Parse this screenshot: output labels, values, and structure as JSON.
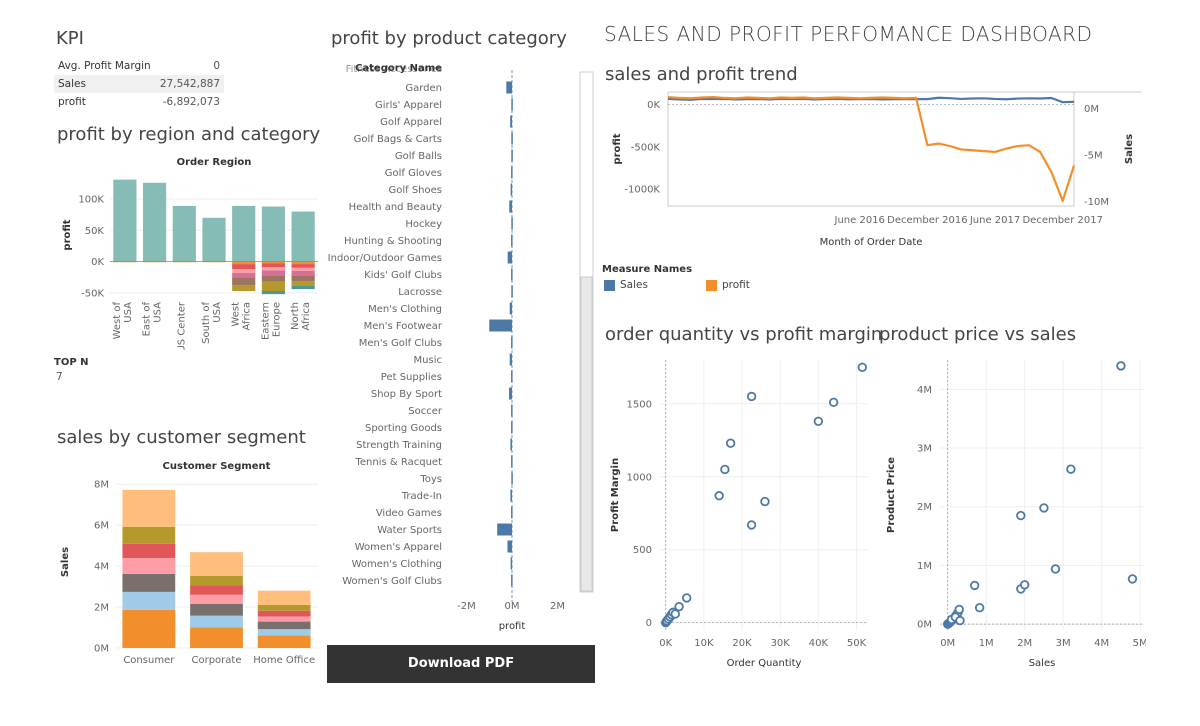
{
  "dashboard_title": "SALES AND PROFIT PERFOMANCE DASHBOARD",
  "kpi": {
    "title": "KPI",
    "rows": [
      {
        "label": "Avg. Profit Margin",
        "value": "0"
      },
      {
        "label": "Sales",
        "value": "27,542,887"
      },
      {
        "label": "profit",
        "value": "-6,892,073"
      }
    ]
  },
  "top_n": {
    "label": "TOP N",
    "value": "7"
  },
  "download_button": "Download PDF",
  "colors": {
    "blue": "#4e79a7",
    "orange": "#f28e2b",
    "teal": "#86bcb6"
  },
  "chart_data": [
    {
      "id": "region",
      "type": "bar",
      "title": "profit by region and category",
      "header": "Order Region",
      "ylabel": "profit",
      "ylim": [
        -55000,
        140000
      ],
      "yticks": [
        100000,
        50000,
        0,
        -50000
      ],
      "ytick_labels": [
        "100K",
        "50K",
        "0K",
        "-50K"
      ],
      "categories": [
        "West of USA",
        "East of USA",
        "US Center",
        "South of USA",
        "West Africa",
        "Eastern Europe",
        "North Africa"
      ],
      "category_labels": [
        [
          "West of",
          "USA"
        ],
        [
          "East of",
          "USA"
        ],
        [
          "US Center"
        ],
        [
          "South of",
          "USA"
        ],
        [
          "West",
          "Africa"
        ],
        [
          "Eastern",
          "Europe"
        ],
        [
          "North",
          "Africa"
        ]
      ],
      "positive": [
        131000,
        126000,
        89000,
        70000,
        89000,
        88000,
        80000
      ],
      "negative_segments": [
        [
          -1000
        ],
        [
          -1000
        ],
        [
          -1000
        ],
        [
          -1000
        ],
        [
          -4000,
          -8000,
          -6000,
          -7000,
          -13000,
          -9000
        ],
        [
          -3000,
          -6000,
          -5000,
          -8000,
          -10000,
          -15000,
          -5000
        ],
        [
          -4000,
          -6000,
          -5000,
          -7000,
          -9000,
          -8000,
          -5000
        ]
      ],
      "segment_colors": [
        "#f28e2b",
        "#e15759",
        "#ff9da7",
        "#d37295",
        "#9c755f",
        "#b6992d",
        "#499894",
        "#79706e"
      ]
    },
    {
      "id": "segment",
      "type": "bar",
      "title": "sales by customer segment",
      "header": "Customer Segment",
      "ylabel": "Sales",
      "ylim": [
        0,
        8400000
      ],
      "yticks": [
        0,
        2000000,
        4000000,
        6000000,
        8000000
      ],
      "ytick_labels": [
        "0M",
        "2M",
        "4M",
        "6M",
        "8M"
      ],
      "categories": [
        "Consumer",
        "Corporate",
        "Home Office"
      ],
      "stack_colors": [
        "#f28e2b",
        "#a0cbe8",
        "#79706e",
        "#ff9da7",
        "#e15759",
        "#b6992d",
        "#ffbe7d"
      ],
      "stacks": [
        [
          1860000,
          880000,
          880000,
          770000,
          700000,
          830000,
          1800000
        ],
        [
          1000000,
          580000,
          580000,
          440000,
          450000,
          480000,
          1150000
        ],
        [
          620000,
          300000,
          370000,
          250000,
          280000,
          280000,
          700000
        ]
      ]
    },
    {
      "id": "category",
      "type": "bar",
      "orientation": "horizontal",
      "title": "profit by product category",
      "ylabel": "Category Name",
      "xlabel": "profit",
      "xlim": [
        -2900000,
        2900000
      ],
      "xticks": [
        -2000000,
        0,
        2000000
      ],
      "xtick_labels": [
        "-2M",
        "0M",
        "2M"
      ],
      "top_partial_label": "Fitness Accessories",
      "categories": [
        "Garden",
        "Girls' Apparel",
        "Golf Apparel",
        "Golf Bags & Carts",
        "Golf Balls",
        "Golf Gloves",
        "Golf Shoes",
        "Health and Beauty",
        "Hockey",
        "Hunting & Shooting",
        "Indoor/Outdoor Games",
        "Kids' Golf Clubs",
        "Lacrosse",
        "Men's Clothing",
        "Men's Footwear",
        "Men's Golf Clubs",
        "Music",
        "Pet Supplies",
        "Shop By Sport",
        "Soccer",
        "Sporting Goods",
        "Strength Training",
        "Tennis & Racquet",
        "Toys",
        "Trade-In",
        "Video Games",
        "Water Sports",
        "Women's Apparel",
        "Women's Clothing",
        "Women's Golf Clubs"
      ],
      "values": [
        -250000,
        -30000,
        -80000,
        -30000,
        -30000,
        -40000,
        -60000,
        -120000,
        -30000,
        -40000,
        -190000,
        -40000,
        -30000,
        -100000,
        -1000000,
        -40000,
        -100000,
        -40000,
        -130000,
        -40000,
        -40000,
        -70000,
        -40000,
        -30000,
        -70000,
        -40000,
        -650000,
        -200000,
        -60000,
        -40000
      ]
    },
    {
      "id": "trend",
      "type": "line",
      "title": "sales and profit trend",
      "xlabel": "Month of Order Date",
      "ylabel": "profit",
      "y2label": "Sales",
      "ylim": [
        -1200000,
        150000
      ],
      "yticks": [
        0,
        -500000,
        -1000000
      ],
      "ytick_labels": [
        "0K",
        "-500K",
        "-1000K"
      ],
      "y2lim": [
        -10500000,
        1800000
      ],
      "y2ticks": [
        0,
        -5000000,
        -10000000
      ],
      "y2tick_labels": [
        "0M",
        "-5M",
        "-10M"
      ],
      "x_start": "2015-01",
      "x_end": "2018-01",
      "xticks": [
        "2016-06",
        "2016-12",
        "2017-06",
        "2017-12"
      ],
      "xtick_labels": [
        "June 2016",
        "December 2016",
        "June 2017",
        "December 2017"
      ],
      "x": [
        "2015-01",
        "2015-02",
        "2015-03",
        "2015-04",
        "2015-05",
        "2015-06",
        "2015-07",
        "2015-08",
        "2015-09",
        "2015-10",
        "2015-11",
        "2015-12",
        "2016-01",
        "2016-02",
        "2016-03",
        "2016-04",
        "2016-05",
        "2016-06",
        "2016-07",
        "2016-08",
        "2016-09",
        "2016-10",
        "2016-11",
        "2016-12",
        "2017-01",
        "2017-02",
        "2017-03",
        "2017-04",
        "2017-05",
        "2017-06",
        "2017-07",
        "2017-08",
        "2017-09",
        "2017-10",
        "2017-11",
        "2017-12",
        "2018-01"
      ],
      "series": [
        {
          "name": "Sales",
          "axis": "y2",
          "color": "#4e79a7",
          "values": [
            1050000,
            1000000,
            960000,
            1060000,
            1040000,
            1050000,
            1000000,
            1030000,
            1040000,
            1000000,
            1050000,
            1040000,
            1060000,
            1000000,
            1040000,
            1050000,
            1010000,
            1030000,
            1040000,
            1000000,
            1030000,
            1030000,
            1030000,
            1030000,
            1180000,
            1130000,
            1050000,
            1100000,
            1120000,
            1050000,
            1020000,
            1090000,
            1120000,
            1100000,
            1150000,
            700000,
            740000
          ]
        },
        {
          "name": "profit",
          "axis": "y",
          "color": "#f28e2b",
          "values": [
            90000,
            80000,
            75000,
            85000,
            90000,
            80000,
            75000,
            85000,
            80000,
            75000,
            85000,
            80000,
            85000,
            75000,
            80000,
            85000,
            80000,
            75000,
            80000,
            85000,
            80000,
            75000,
            80000,
            -480000,
            -460000,
            -490000,
            -530000,
            -540000,
            -550000,
            -560000,
            -520000,
            -490000,
            -480000,
            -560000,
            -800000,
            -1140000,
            -720000
          ]
        }
      ],
      "legend": {
        "title": "Measure Names",
        "items": [
          "Sales",
          "profit"
        ]
      }
    },
    {
      "id": "qty_margin",
      "type": "scatter",
      "title": "order quantity vs profit margin",
      "xlabel": "Order Quantity",
      "ylabel": "Profit Margin",
      "xlim": [
        -1500,
        53000
      ],
      "ylim": [
        -50,
        1800
      ],
      "xticks": [
        0,
        10000,
        20000,
        30000,
        40000,
        50000
      ],
      "xtick_labels": [
        "0K",
        "10K",
        "20K",
        "30K",
        "40K",
        "50K"
      ],
      "yticks": [
        0,
        500,
        1000,
        1500
      ],
      "ytick_labels": [
        "0",
        "500",
        "1000",
        "1500"
      ],
      "points": [
        [
          0,
          0
        ],
        [
          200,
          8
        ],
        [
          400,
          15
        ],
        [
          600,
          20
        ],
        [
          800,
          28
        ],
        [
          1000,
          35
        ],
        [
          1200,
          42
        ],
        [
          1400,
          50
        ],
        [
          1600,
          58
        ],
        [
          1800,
          65
        ],
        [
          2000,
          72
        ],
        [
          300,
          12
        ],
        [
          700,
          25
        ],
        [
          1100,
          40
        ],
        [
          1500,
          55
        ],
        [
          1900,
          70
        ],
        [
          2500,
          60
        ],
        [
          3500,
          110
        ],
        [
          5500,
          170
        ],
        [
          14000,
          870
        ],
        [
          15500,
          1050
        ],
        [
          17000,
          1230
        ],
        [
          22500,
          1550
        ],
        [
          22500,
          670
        ],
        [
          26000,
          830
        ],
        [
          40000,
          1380
        ],
        [
          44000,
          1510
        ],
        [
          51500,
          1750
        ]
      ]
    },
    {
      "id": "price_sales",
      "type": "scatter",
      "title": "product price vs sales",
      "xlabel": "Sales",
      "ylabel": "Product Price",
      "xlim": [
        -200000,
        5100000
      ],
      "ylim": [
        -100000,
        4500000
      ],
      "xticks": [
        0,
        1000000,
        2000000,
        3000000,
        4000000,
        5000000
      ],
      "xtick_labels": [
        "0M",
        "1M",
        "2M",
        "3M",
        "4M",
        "5M"
      ],
      "yticks": [
        0,
        1000000,
        2000000,
        3000000,
        4000000
      ],
      "ytick_labels": [
        "0M",
        "1M",
        "2M",
        "3M",
        "4M"
      ],
      "points": [
        [
          0,
          0
        ],
        [
          30000,
          15000
        ],
        [
          60000,
          30000
        ],
        [
          90000,
          50000
        ],
        [
          120000,
          70000
        ],
        [
          150000,
          90000
        ],
        [
          180000,
          110000
        ],
        [
          210000,
          140000
        ],
        [
          240000,
          170000
        ],
        [
          270000,
          200000
        ],
        [
          300000,
          250000
        ],
        [
          100000,
          80000
        ],
        [
          200000,
          120000
        ],
        [
          320000,
          60000
        ],
        [
          700000,
          660000
        ],
        [
          830000,
          280000
        ],
        [
          1900000,
          600000
        ],
        [
          2000000,
          670000
        ],
        [
          1900000,
          1850000
        ],
        [
          2500000,
          1980000
        ],
        [
          2800000,
          940000
        ],
        [
          3200000,
          2640000
        ],
        [
          4500000,
          4400000
        ],
        [
          4800000,
          770000
        ]
      ]
    }
  ]
}
